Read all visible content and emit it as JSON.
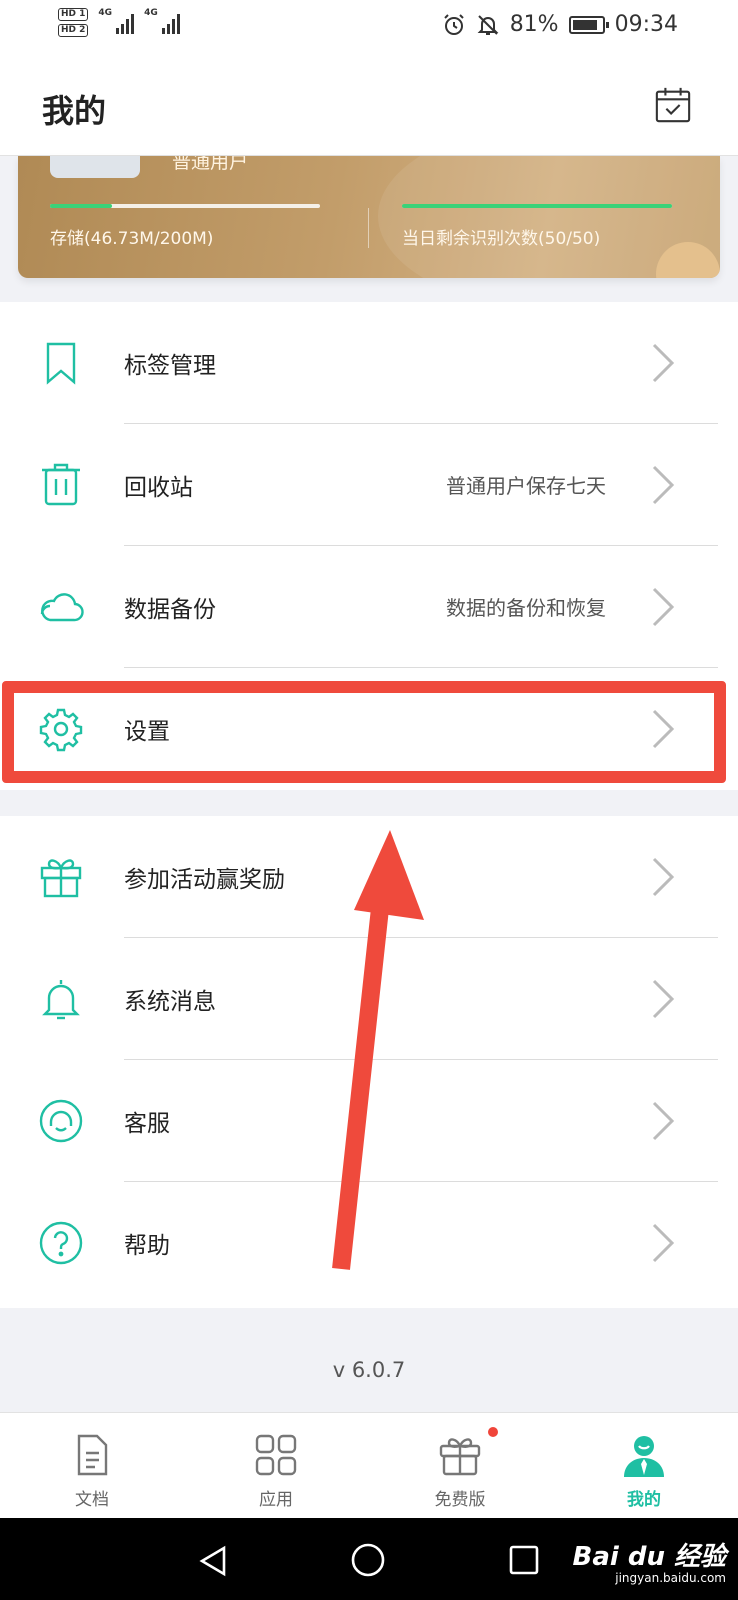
{
  "status_bar": {
    "hd1": "HD 1",
    "hd2": "HD 2",
    "net1": "4G",
    "net2": "4G",
    "battery": "81%",
    "time": "09:34"
  },
  "header": {
    "title": "我的"
  },
  "card": {
    "user_type": "普通用户",
    "storage_label": "存储(46.73M/200M)",
    "storage_used_fraction": 0.23,
    "recognition_label": "当日剩余识别次数(50/50)",
    "recognition_remaining_fraction": 1.0,
    "accent_color": "#3ad278"
  },
  "menu_group_1": [
    {
      "label": "标签管理",
      "sub": "",
      "icon": "bookmark-icon"
    },
    {
      "label": "回收站",
      "sub": "普通用户保存七天",
      "icon": "trash-icon"
    },
    {
      "label": "数据备份",
      "sub": "数据的备份和恢复",
      "icon": "cloud-icon"
    },
    {
      "label": "设置",
      "sub": "",
      "icon": "gear-icon"
    }
  ],
  "menu_group_2": [
    {
      "label": "参加活动赢奖励",
      "sub": "",
      "icon": "gift-icon"
    },
    {
      "label": "系统消息",
      "sub": "",
      "icon": "bell-icon"
    },
    {
      "label": "客服",
      "sub": "",
      "icon": "headset-icon"
    },
    {
      "label": "帮助",
      "sub": "",
      "icon": "help-icon"
    }
  ],
  "version": "v 6.0.7",
  "tabs": [
    {
      "label": "文档",
      "icon": "document-icon",
      "active": false
    },
    {
      "label": "应用",
      "icon": "apps-grid-icon",
      "active": false
    },
    {
      "label": "免费版",
      "icon": "gift-box-icon",
      "active": false,
      "badge": true
    },
    {
      "label": "我的",
      "icon": "person-icon",
      "active": true
    }
  ],
  "colors": {
    "accent": "#1fbfa3",
    "highlight": "#ef4a3c",
    "card_gold": "#c29d6a"
  },
  "watermark": {
    "brand": "Bai du 经验",
    "url": "jingyan.baidu.com"
  }
}
